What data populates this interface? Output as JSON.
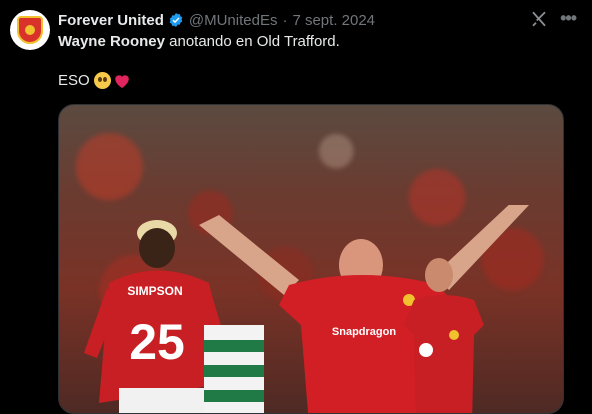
{
  "author": {
    "name": "Forever United",
    "handle": "@MUnitedEs",
    "separator": "·",
    "date": "7 sept. 2024",
    "verified": true
  },
  "tweet": {
    "line1_bold": "Wayne Rooney",
    "line1_rest": " anotando en Old Trafford.",
    "line2_text": "ESO"
  },
  "photo": {
    "left_player_name": "SIMPSON",
    "left_player_number": "25",
    "sponsor": "Snapdragon"
  },
  "icons": {
    "verified": "verified-badge-icon",
    "grok": "grok-icon",
    "more": "more-icon",
    "emoji_face": "pleading-face-emoji",
    "emoji_heart": "red-heart-emoji"
  },
  "colors": {
    "background": "#000000",
    "verified_blue": "#1d9bf0",
    "muted": "#71767b",
    "text": "#e7e9ea",
    "kit_red": "#d21f26"
  }
}
